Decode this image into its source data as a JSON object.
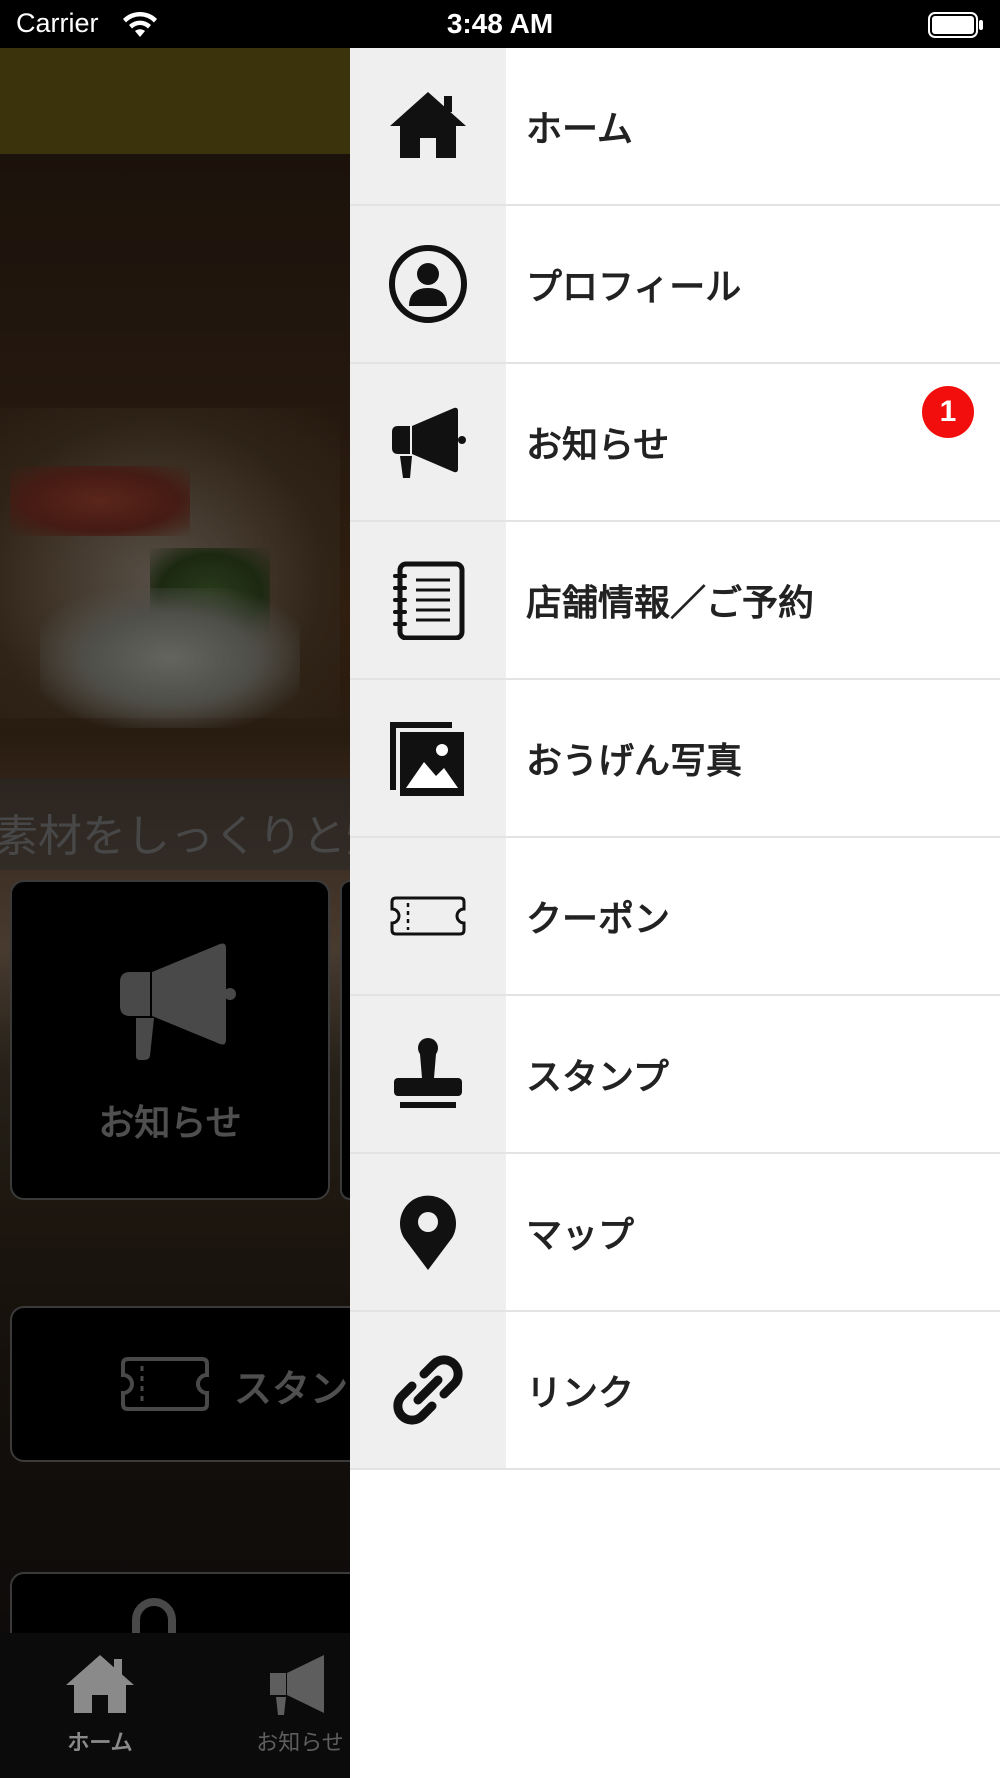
{
  "status_bar": {
    "carrier": "Carrier",
    "time": "3:48 AM"
  },
  "background": {
    "caption": "素材をしっくりと炊",
    "tile_label": "お知らせ",
    "button_label": "スタン",
    "tabbar": {
      "home_label": "ホーム",
      "news_label": "お知らせ"
    }
  },
  "drawer": {
    "items": [
      {
        "label": "ホーム",
        "icon": "home-icon"
      },
      {
        "label": "プロフィール",
        "icon": "profile-icon"
      },
      {
        "label": "お知らせ",
        "icon": "megaphone-icon",
        "badge": "1"
      },
      {
        "label": "店舗情報／ご予約",
        "icon": "notebook-icon"
      },
      {
        "label": "おうげん写真",
        "icon": "photos-icon"
      },
      {
        "label": "クーポン",
        "icon": "coupon-ticket-icon"
      },
      {
        "label": "スタンプ",
        "icon": "stamp-icon"
      },
      {
        "label": "マップ",
        "icon": "map-pin-icon"
      },
      {
        "label": "リンク",
        "icon": "link-icon"
      }
    ]
  },
  "colors": {
    "badge": "#f30e0e",
    "icon_cell": "#efefef",
    "header_bg": "#5b4f12"
  }
}
